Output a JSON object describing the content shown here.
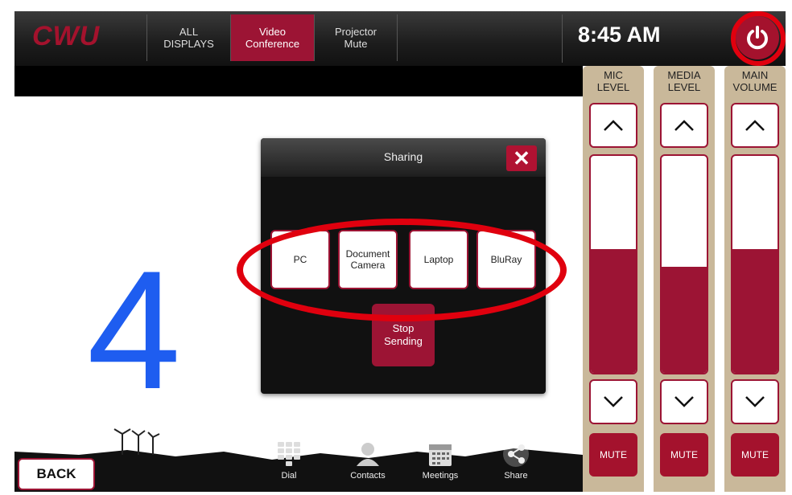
{
  "header": {
    "logo": "CWU",
    "tabs": [
      {
        "line1": "ALL",
        "line2": "DISPLAYS"
      },
      {
        "line1": "Video",
        "line2": "Conference"
      },
      {
        "line1": "Projector",
        "line2": "Mute"
      }
    ],
    "clock": "8:45 AM"
  },
  "annotation": {
    "number": "4"
  },
  "dialog": {
    "title": "Sharing",
    "close": "✕",
    "sources": [
      {
        "line1": "PC",
        "line2": ""
      },
      {
        "line1": "Document",
        "line2": "Camera"
      },
      {
        "line1": "Laptop",
        "line2": ""
      },
      {
        "line1": "BluRay",
        "line2": ""
      }
    ],
    "stop": {
      "line1": "Stop",
      "line2": "Sending"
    }
  },
  "levels": [
    {
      "line1": "MIC",
      "line2": "LEVEL",
      "level": 0.57,
      "mute": "MUTE"
    },
    {
      "line1": "MEDIA",
      "line2": "LEVEL",
      "level": 0.49,
      "mute": "MUTE"
    },
    {
      "line1": "MAIN",
      "line2": "VOLUME",
      "level": 0.57,
      "mute": "MUTE"
    }
  ],
  "footer": {
    "back": "BACK",
    "nav": [
      "Dial",
      "Contacts",
      "Meetings",
      "Share"
    ]
  },
  "colors": {
    "accent": "#9c1434",
    "annotation_red": "#e0000e",
    "annotation_blue": "#1e5df0"
  }
}
